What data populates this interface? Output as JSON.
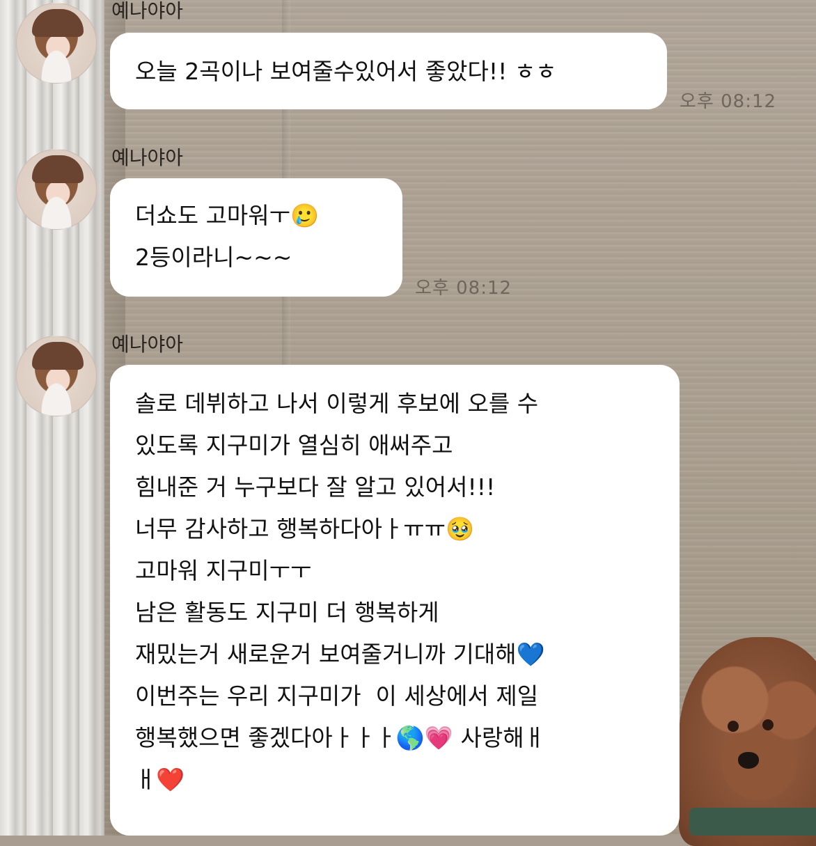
{
  "chat": {
    "messages": [
      {
        "sender": "예나야아",
        "lines": [
          "오늘 2곡이나 보여줄수있어서 좋았다!! ㅎㅎ"
        ],
        "time": "오후 08:12"
      },
      {
        "sender": "예나야아",
        "lines": [
          "더쇼도 고마워ㅜ🥲",
          "2등이라니~~~"
        ],
        "time": "오후 08:12"
      },
      {
        "sender": "예나야아",
        "lines": [
          "솔로 데뷔하고 나서 이렇게 후보에 오를 수",
          "있도록 지구미가 열심히 애써주고",
          "힘내준 거 누구보다 잘 알고 있어서!!!",
          "너무 감사하고 행복하다아ㅏㅠㅠ🥹",
          "고마워 지구미ㅜㅜ",
          "남은 활동도 지구미 더 행복하게",
          "재밌는거 새로운거 보여줄거니까 기대해💙",
          "이번주는 우리 지구미가  이 세상에서 제일",
          "행복했으면 좋겠다아ㅏㅏㅏ🌎💗 사랑해ㅐ",
          "ㅐ❤️"
        ],
        "time": ""
      }
    ]
  }
}
